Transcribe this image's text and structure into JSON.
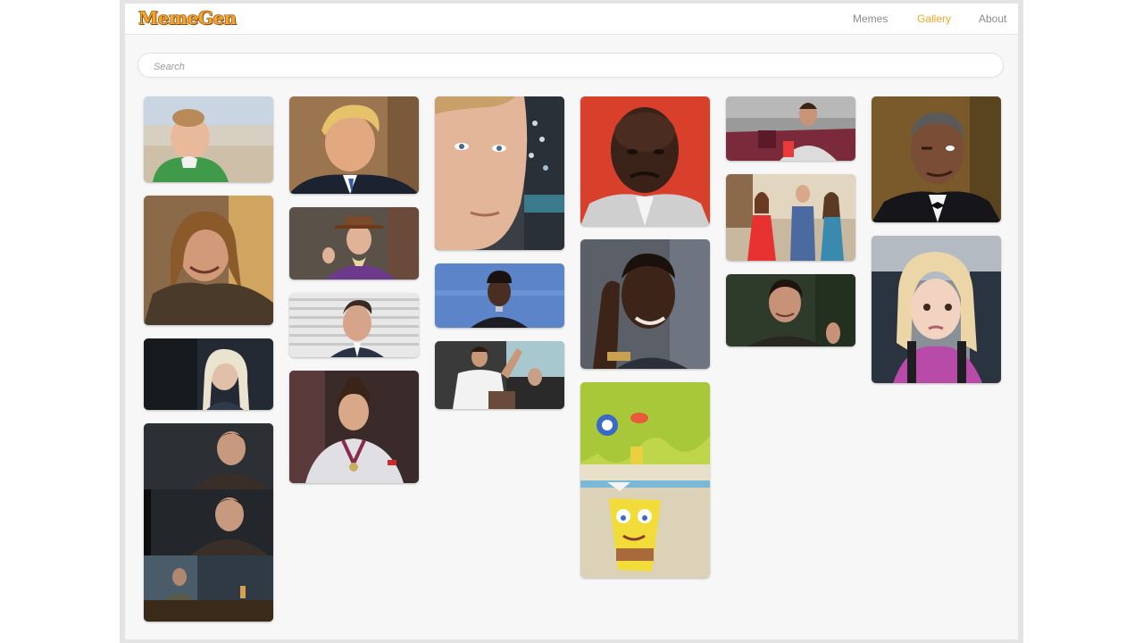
{
  "app": {
    "logo_text": "MemeGen"
  },
  "nav": {
    "items": [
      {
        "label": "Memes",
        "active": false
      },
      {
        "label": "Gallery",
        "active": true
      },
      {
        "label": "About",
        "active": false
      }
    ]
  },
  "search": {
    "placeholder": "Search",
    "value": ""
  },
  "colors": {
    "accent": "#f5a623",
    "nav_inactive": "#8a8a8a",
    "background": "#f7f7f7"
  },
  "gallery": {
    "images": [
      {
        "name": "success-kid-meme"
      },
      {
        "name": "trump-meme"
      },
      {
        "name": "closeup-face-meme"
      },
      {
        "name": "crying-jordan-meme"
      },
      {
        "name": "car-drinking-meme"
      },
      {
        "name": "obama-wink-meme"
      },
      {
        "name": "one-does-not-simply-meme"
      },
      {
        "name": "willy-wonka-meme"
      },
      {
        "name": "21-savage-meme"
      },
      {
        "name": "roll-safe-meme"
      },
      {
        "name": "distracted-boyfriend-meme"
      },
      {
        "name": "side-eye-chloe-meme"
      },
      {
        "name": "office-michael-meme"
      },
      {
        "name": "salt-bae-meme"
      },
      {
        "name": "joey-friends-meme"
      },
      {
        "name": "daenerys-smile-meme"
      },
      {
        "name": "not-impressed-gymnast-meme"
      },
      {
        "name": "spongebob-meme"
      },
      {
        "name": "sam-tarly-meme"
      }
    ]
  }
}
